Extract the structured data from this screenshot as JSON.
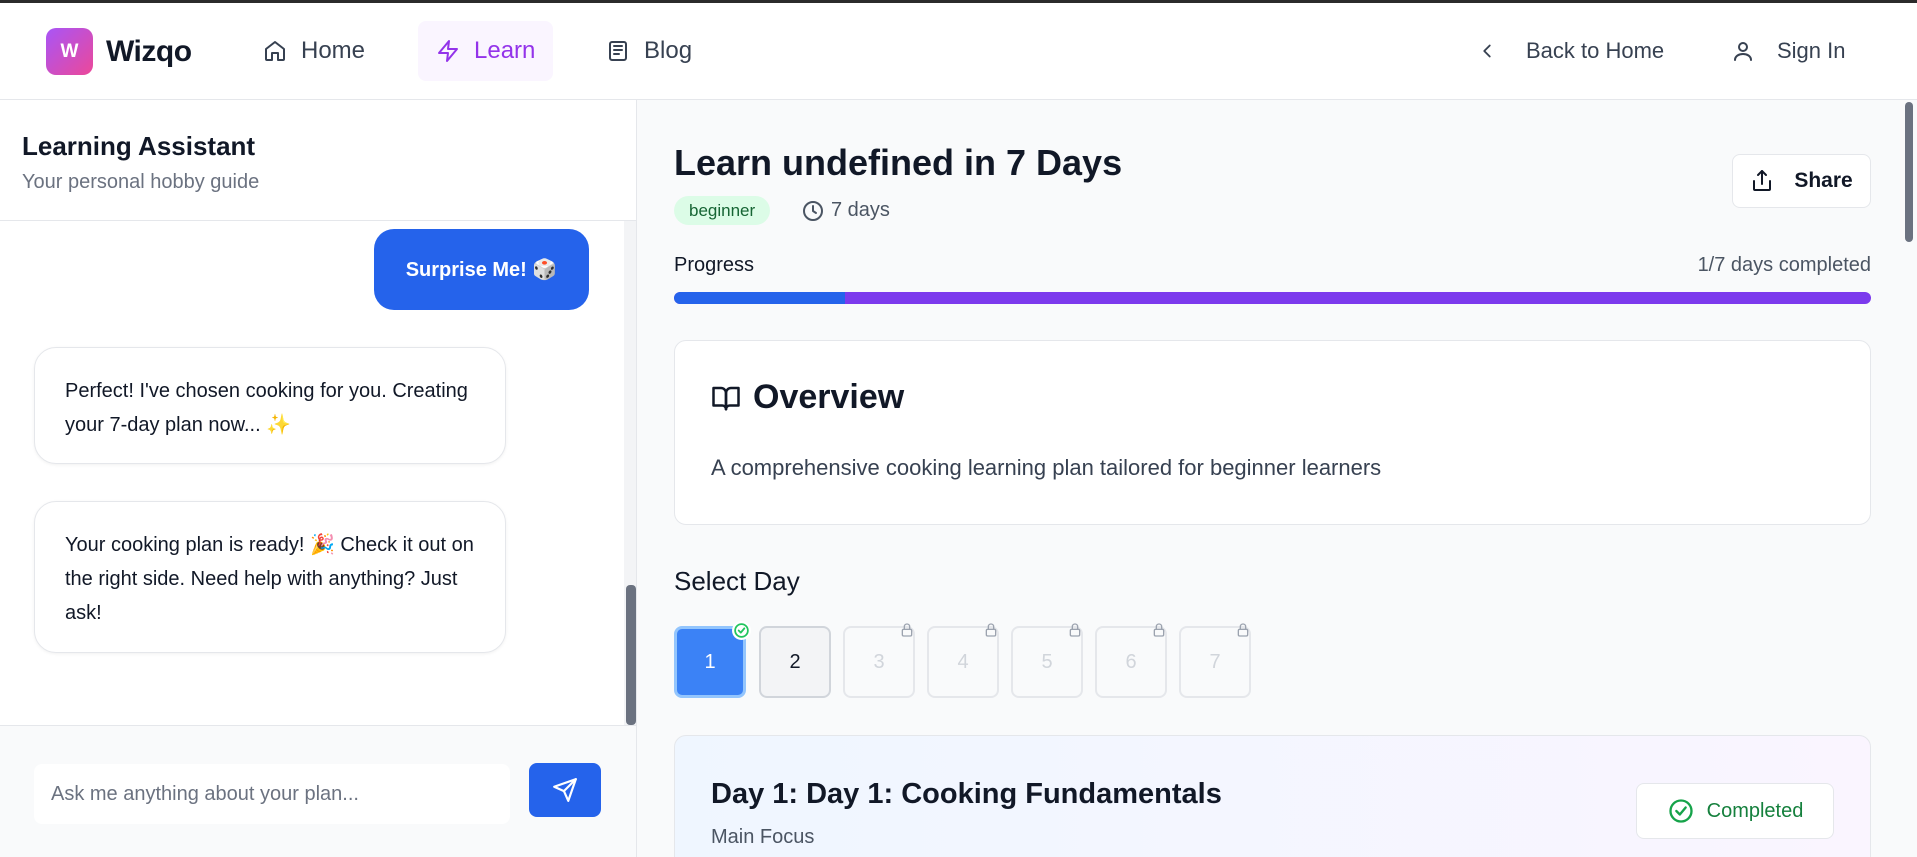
{
  "brand": {
    "logo_letter": "W",
    "name": "Wizqo"
  },
  "nav": {
    "home": "Home",
    "learn": "Learn",
    "blog": "Blog",
    "back": "Back to Home",
    "signin": "Sign In"
  },
  "assistant": {
    "title": "Learning Assistant",
    "subtitle": "Your personal hobby guide",
    "messages": [
      {
        "role": "user",
        "text": "Surprise Me! 🎲"
      },
      {
        "role": "bot",
        "text": "Perfect! I've chosen cooking for you. Creating your 7-day plan now... ✨"
      },
      {
        "role": "bot",
        "text": "Your cooking plan is ready! 🎉 Check it out on the right side. Need help with anything? Just ask!"
      }
    ],
    "input_placeholder": "Ask me anything about your plan..."
  },
  "plan": {
    "title": "Learn undefined in 7 Days",
    "level": "beginner",
    "duration": "7 days",
    "share": "Share",
    "progress_label": "Progress",
    "progress_text": "1/7 days completed",
    "progress_fraction": 0.1429,
    "overview_title": "Overview",
    "overview_text": "A comprehensive cooking learning plan tailored for beginner learners",
    "select_day": "Select Day",
    "days": [
      "1",
      "2",
      "3",
      "4",
      "5",
      "6",
      "7"
    ],
    "day_card": {
      "title": "Day 1: Day 1: Cooking Fundamentals",
      "focus": "Main Focus",
      "status": "Completed"
    }
  },
  "colors": {
    "primary": "#2563eb",
    "accent": "#7c3aed",
    "brand_gradient_start": "#a855f7",
    "brand_gradient_end": "#ec4899",
    "success": "#16a34a"
  }
}
